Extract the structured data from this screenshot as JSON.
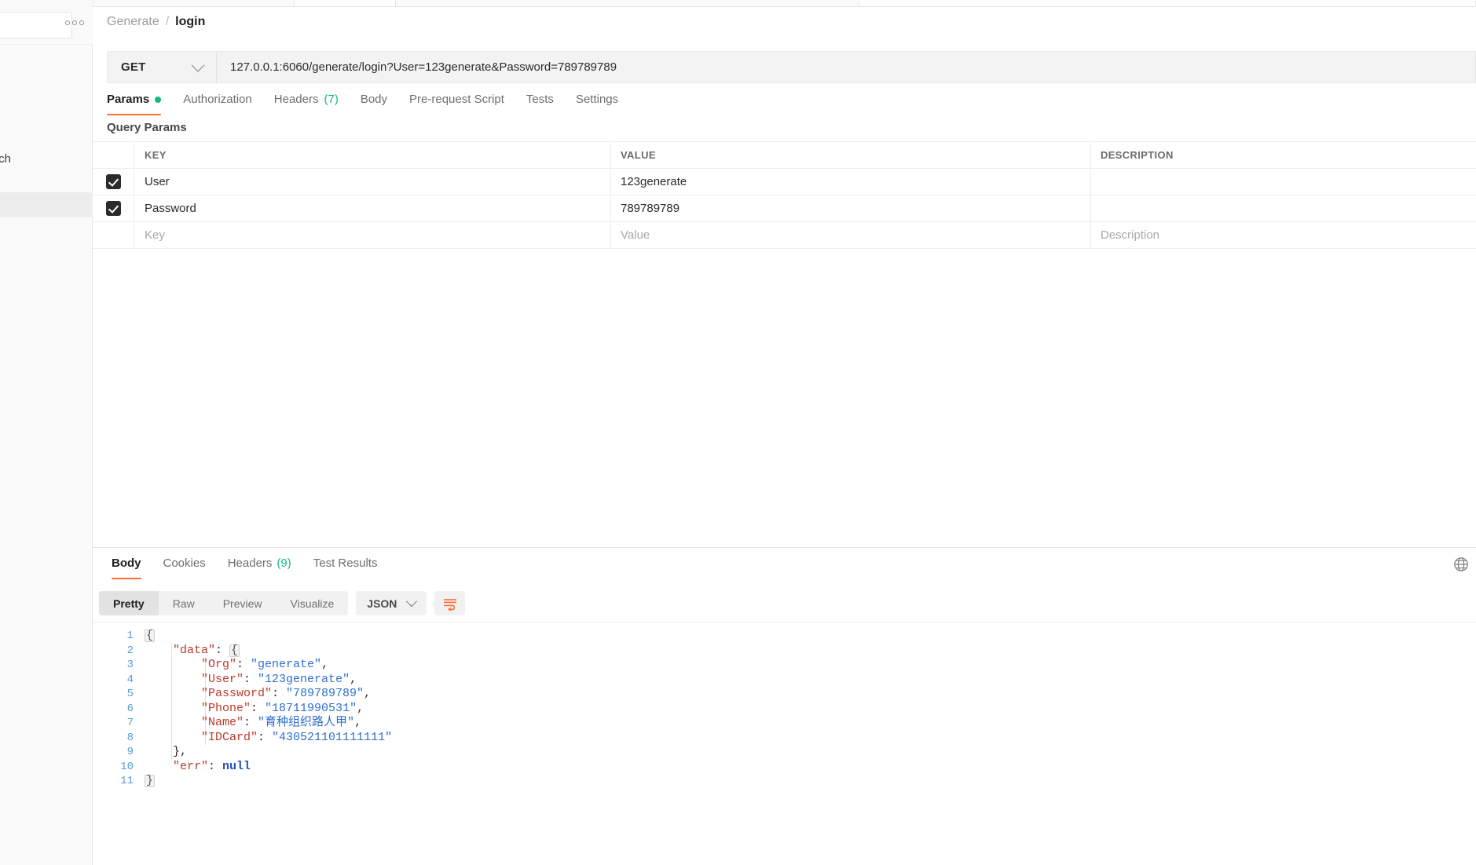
{
  "sidebar": {
    "search_placeholder": "",
    "more_actions_label": "",
    "truncated_item_label": "ch"
  },
  "breadcrumb": {
    "root": "Generate",
    "separator": "/",
    "leaf": "login"
  },
  "request": {
    "method": "GET",
    "url": "127.0.0.1:6060/generate/login?User=123generate&Password=789789789",
    "tabs": [
      {
        "label": "Params",
        "badge": "dot",
        "active": true
      },
      {
        "label": "Authorization",
        "badge": "",
        "active": false
      },
      {
        "label": "Headers",
        "badge": "(7)",
        "active": false
      },
      {
        "label": "Body",
        "badge": "",
        "active": false
      },
      {
        "label": "Pre-request Script",
        "badge": "",
        "active": false
      },
      {
        "label": "Tests",
        "badge": "",
        "active": false
      },
      {
        "label": "Settings",
        "badge": "",
        "active": false
      }
    ],
    "query_params": {
      "section_title": "Query Params",
      "columns": [
        "KEY",
        "VALUE",
        "DESCRIPTION"
      ],
      "rows": [
        {
          "checked": true,
          "key": "User",
          "value": "123generate",
          "description": ""
        },
        {
          "checked": true,
          "key": "Password",
          "value": "789789789",
          "description": ""
        }
      ],
      "new_row_placeholders": {
        "key": "Key",
        "value": "Value",
        "description": "Description"
      }
    }
  },
  "response": {
    "tabs": [
      {
        "label": "Body",
        "badge": "",
        "active": true
      },
      {
        "label": "Cookies",
        "badge": "",
        "active": false
      },
      {
        "label": "Headers",
        "badge": "(9)",
        "active": false
      },
      {
        "label": "Test Results",
        "badge": "",
        "active": false
      }
    ],
    "view_modes": [
      {
        "label": "Pretty",
        "active": true
      },
      {
        "label": "Raw",
        "active": false
      },
      {
        "label": "Preview",
        "active": false
      },
      {
        "label": "Visualize",
        "active": false
      }
    ],
    "format": "JSON",
    "wrap_icon": "wrap-lines-icon",
    "globe_icon": "globe-icon",
    "body_lines": [
      {
        "n": "1",
        "indent": 0,
        "tokens": [
          {
            "t": "fold",
            "v": "{"
          }
        ]
      },
      {
        "n": "2",
        "indent": 1,
        "tokens": [
          {
            "t": "key",
            "v": "\"data\""
          },
          {
            "t": "punc",
            "v": ": "
          },
          {
            "t": "fold",
            "v": "{"
          }
        ]
      },
      {
        "n": "3",
        "indent": 2,
        "tokens": [
          {
            "t": "key",
            "v": "\"Org\""
          },
          {
            "t": "punc",
            "v": ": "
          },
          {
            "t": "str",
            "v": "\"generate\""
          },
          {
            "t": "punc",
            "v": ","
          }
        ]
      },
      {
        "n": "4",
        "indent": 2,
        "tokens": [
          {
            "t": "key",
            "v": "\"User\""
          },
          {
            "t": "punc",
            "v": ": "
          },
          {
            "t": "str",
            "v": "\"123generate\""
          },
          {
            "t": "punc",
            "v": ","
          }
        ]
      },
      {
        "n": "5",
        "indent": 2,
        "tokens": [
          {
            "t": "key",
            "v": "\"Password\""
          },
          {
            "t": "punc",
            "v": ": "
          },
          {
            "t": "str",
            "v": "\"789789789\""
          },
          {
            "t": "punc",
            "v": ","
          }
        ]
      },
      {
        "n": "6",
        "indent": 2,
        "tokens": [
          {
            "t": "key",
            "v": "\"Phone\""
          },
          {
            "t": "punc",
            "v": ": "
          },
          {
            "t": "str",
            "v": "\"18711990531\""
          },
          {
            "t": "punc",
            "v": ","
          }
        ]
      },
      {
        "n": "7",
        "indent": 2,
        "tokens": [
          {
            "t": "key",
            "v": "\"Name\""
          },
          {
            "t": "punc",
            "v": ": "
          },
          {
            "t": "str",
            "v": "\"育种组织路人甲\""
          },
          {
            "t": "punc",
            "v": ","
          }
        ]
      },
      {
        "n": "8",
        "indent": 2,
        "tokens": [
          {
            "t": "key",
            "v": "\"IDCard\""
          },
          {
            "t": "punc",
            "v": ": "
          },
          {
            "t": "str",
            "v": "\"430521101111111\""
          }
        ]
      },
      {
        "n": "9",
        "indent": 1,
        "tokens": [
          {
            "t": "punc",
            "v": "},"
          }
        ]
      },
      {
        "n": "10",
        "indent": 1,
        "tokens": [
          {
            "t": "key",
            "v": "\"err\""
          },
          {
            "t": "punc",
            "v": ": "
          },
          {
            "t": "null",
            "v": "null"
          }
        ]
      },
      {
        "n": "11",
        "indent": 0,
        "tokens": [
          {
            "t": "fold",
            "v": "}"
          }
        ]
      }
    ]
  },
  "colors": {
    "accent": "#ff6c37",
    "success": "#12b886",
    "json_key": "#c0392b",
    "json_string": "#2f6fd0",
    "json_keyword": "#1f4fb8",
    "line_number": "#5c9bd6"
  }
}
